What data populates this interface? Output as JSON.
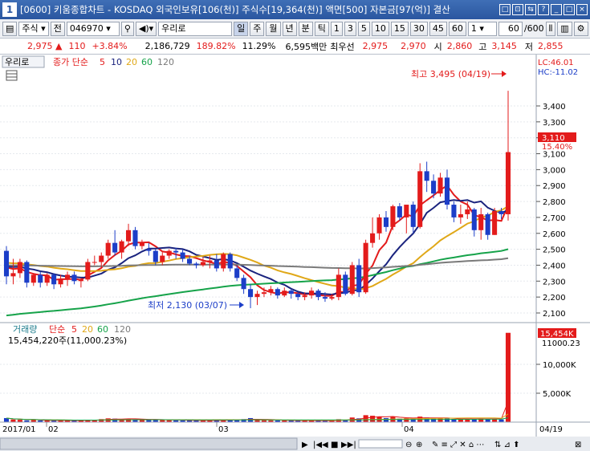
{
  "window": {
    "num": "1",
    "title": "[0600] 키움종합차트 - KOSDAQ 외국인보유[106(천)] 주식수[19,364(천)] 액면[500] 자본금[97(억)] 결산"
  },
  "toolbar": {
    "market": "주식",
    "jeon": "전",
    "code": "046970",
    "stock_name": "우리로",
    "il": "일",
    "ju": "주",
    "wol": "월",
    "nyeon": "년",
    "bun": "분",
    "tik": "틱",
    "periods": [
      "1",
      "3",
      "5",
      "10",
      "15",
      "30",
      "45",
      "60"
    ],
    "sel": "1",
    "count": "60",
    "total": "/600"
  },
  "info": {
    "price": "2,975 ▲",
    "change": "110",
    "pct": "+3.84%",
    "volume": "2,186,729",
    "vol_ratio": "189.82%",
    "turnover": "11.29%",
    "amount": "6,595백만",
    "bid_label": "최우선",
    "bid": "2,975",
    "ask": "2,970",
    "open_label": "시",
    "open": "2,860",
    "high_label": "고",
    "high": "3,145",
    "low_label": "저",
    "low": "2,855"
  },
  "price_panel": {
    "name": "우리로",
    "indicator": "종가 단순",
    "ma": [
      {
        "period": "5",
        "color": "#e31b1b"
      },
      {
        "period": "10",
        "color": "#1a237e"
      },
      {
        "period": "20",
        "color": "#e0a818"
      },
      {
        "period": "60",
        "color": "#16a34a"
      },
      {
        "period": "120",
        "color": "#7a7a7a"
      }
    ],
    "lc": "LC:46.01",
    "hc": "HC:-11.02",
    "max_label": "최고 3,495 (04/19)",
    "min_label": "최저 2,130 (03/07)",
    "cur_price": "3,110",
    "cur_pct": "15.40%"
  },
  "volume_panel": {
    "name": "거래량",
    "indicator": "단순",
    "ma": [
      {
        "period": "5",
        "color": "#e31b1b"
      },
      {
        "period": "20",
        "color": "#e0a818"
      },
      {
        "period": "60",
        "color": "#16a34a"
      },
      {
        "period": "120",
        "color": "#7a7a7a"
      }
    ],
    "vol_text": "15,454,220주(11,000.23%)",
    "cur_vol": "15,454K",
    "cur_vol2": "11000.23"
  },
  "x_labels": [
    "2017/01",
    "02",
    "03",
    "04"
  ],
  "last_date": "04/19",
  "chart_data": {
    "type": "candlestick",
    "y_ticks": [
      2100,
      2200,
      2300,
      2400,
      2500,
      2600,
      2700,
      2800,
      2900,
      3000,
      3100,
      3200,
      3300,
      3400
    ],
    "y_tick_labels": [
      "2,100",
      "2,200",
      "2,300",
      "2,400",
      "2,500",
      "2,600",
      "2,700",
      "2,800",
      "2,900",
      "3,000",
      "3,100",
      "3,200",
      "3,300",
      "3,400"
    ],
    "vol_ticks": [
      5000,
      10000
    ],
    "vol_tick_labels": [
      "5,000K",
      "10,000K"
    ],
    "candles": [
      [
        2490,
        2520,
        2280,
        2330
      ],
      [
        2330,
        2440,
        2280,
        2350
      ],
      [
        2350,
        2440,
        2320,
        2420
      ],
      [
        2420,
        2430,
        2260,
        2290
      ],
      [
        2290,
        2350,
        2270,
        2340
      ],
      [
        2340,
        2360,
        2260,
        2290
      ],
      [
        2290,
        2350,
        2270,
        2340
      ],
      [
        2340,
        2350,
        2250,
        2280
      ],
      [
        2280,
        2340,
        2260,
        2310
      ],
      [
        2310,
        2360,
        2270,
        2340
      ],
      [
        2340,
        2360,
        2280,
        2300
      ],
      [
        2300,
        2320,
        2260,
        2310
      ],
      [
        2310,
        2440,
        2300,
        2420
      ],
      [
        2420,
        2460,
        2400,
        2420
      ],
      [
        2420,
        2480,
        2380,
        2460
      ],
      [
        2460,
        2560,
        2440,
        2540
      ],
      [
        2540,
        2620,
        2460,
        2480
      ],
      [
        2480,
        2560,
        2440,
        2550
      ],
      [
        2550,
        2660,
        2520,
        2620
      ],
      [
        2620,
        2640,
        2500,
        2520
      ],
      [
        2520,
        2560,
        2500,
        2540
      ],
      [
        2500,
        2540,
        2460,
        2490
      ],
      [
        2490,
        2500,
        2400,
        2420
      ],
      [
        2420,
        2480,
        2400,
        2460
      ],
      [
        2460,
        2500,
        2440,
        2490
      ],
      [
        2490,
        2510,
        2440,
        2480
      ],
      [
        2480,
        2500,
        2420,
        2440
      ],
      [
        2440,
        2460,
        2400,
        2410
      ],
      [
        2410,
        2420,
        2380,
        2400
      ],
      [
        2400,
        2450,
        2390,
        2420
      ],
      [
        2420,
        2460,
        2380,
        2430
      ],
      [
        2430,
        2470,
        2360,
        2380
      ],
      [
        2380,
        2480,
        2360,
        2470
      ],
      [
        2470,
        2480,
        2360,
        2380
      ],
      [
        2380,
        2400,
        2300,
        2320
      ],
      [
        2320,
        2340,
        2220,
        2250
      ],
      [
        2250,
        2280,
        2130,
        2200
      ],
      [
        2200,
        2240,
        2150,
        2220
      ],
      [
        2220,
        2260,
        2200,
        2230
      ],
      [
        2230,
        2270,
        2210,
        2250
      ],
      [
        2250,
        2260,
        2190,
        2210
      ],
      [
        2210,
        2260,
        2200,
        2240
      ],
      [
        2240,
        2250,
        2190,
        2220
      ],
      [
        2220,
        2230,
        2180,
        2200
      ],
      [
        2200,
        2230,
        2180,
        2210
      ],
      [
        2210,
        2260,
        2190,
        2240
      ],
      [
        2240,
        2250,
        2180,
        2200
      ],
      [
        2200,
        2230,
        2170,
        2190
      ],
      [
        2190,
        2220,
        2180,
        2200
      ],
      [
        2200,
        2380,
        2180,
        2340
      ],
      [
        2340,
        2360,
        2210,
        2220
      ],
      [
        2220,
        2420,
        2210,
        2400
      ],
      [
        2400,
        2440,
        2200,
        2230
      ],
      [
        2230,
        2560,
        2220,
        2540
      ],
      [
        2540,
        2700,
        2510,
        2600
      ],
      [
        2600,
        2720,
        2560,
        2700
      ],
      [
        2700,
        2740,
        2610,
        2640
      ],
      [
        2640,
        2780,
        2620,
        2770
      ],
      [
        2770,
        2790,
        2680,
        2700
      ],
      [
        2700,
        2720,
        2600,
        2780
      ],
      [
        2780,
        2800,
        2600,
        2640
      ],
      [
        2640,
        3040,
        2630,
        2990
      ],
      [
        2990,
        3050,
        2860,
        2930
      ],
      [
        2930,
        2970,
        2820,
        2850
      ],
      [
        2850,
        2980,
        2830,
        2950
      ],
      [
        2950,
        3000,
        2750,
        2780
      ],
      [
        2780,
        2800,
        2670,
        2700
      ],
      [
        2700,
        2780,
        2660,
        2720
      ],
      [
        2720,
        2800,
        2690,
        2750
      ],
      [
        2750,
        2760,
        2580,
        2620
      ],
      [
        2620,
        2760,
        2560,
        2720
      ],
      [
        2720,
        2730,
        2560,
        2590
      ],
      [
        2590,
        2760,
        2590,
        2740
      ],
      [
        2740,
        2760,
        2690,
        2720
      ],
      [
        2720,
        3495,
        2680,
        3110
      ]
    ],
    "volumes": [
      700,
      450,
      400,
      300,
      350,
      280,
      300,
      260,
      280,
      300,
      260,
      250,
      420,
      380,
      520,
      650,
      600,
      480,
      600,
      500,
      380,
      420,
      450,
      380,
      330,
      320,
      300,
      300,
      280,
      280,
      300,
      330,
      420,
      380,
      420,
      520,
      700,
      400,
      330,
      300,
      280,
      300,
      280,
      260,
      250,
      280,
      260,
      240,
      250,
      500,
      420,
      800,
      650,
      1200,
      1100,
      950,
      700,
      900,
      600,
      680,
      650,
      950,
      800,
      600,
      700,
      650,
      520,
      500,
      480,
      600,
      650,
      520,
      600,
      450,
      15454
    ]
  }
}
